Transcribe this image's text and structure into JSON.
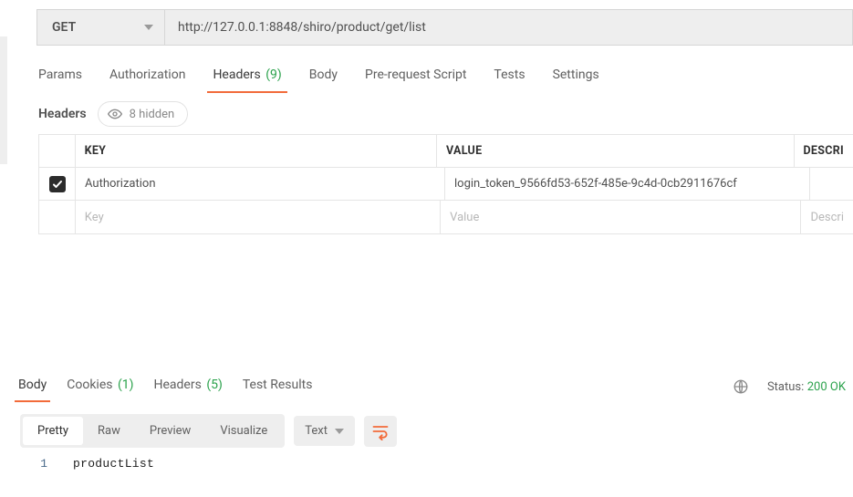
{
  "request": {
    "method": "GET",
    "url": "http://127.0.0.1:8848/shiro/product/get/list",
    "tabs": {
      "params": "Params",
      "authorization": "Authorization",
      "headers_label": "Headers",
      "headers_count": "(9)",
      "body": "Body",
      "prerequest": "Pre-request Script",
      "tests": "Tests",
      "settings": "Settings"
    }
  },
  "headers_section": {
    "title": "Headers",
    "hidden_label": "8 hidden",
    "columns": {
      "key": "KEY",
      "value": "VALUE",
      "desc": "DESCRI"
    },
    "row1": {
      "checked": true,
      "key": "Authorization",
      "value": "login_token_9566fd53-652f-485e-9c4d-0cb2911676cf"
    },
    "placeholders": {
      "key": "Key",
      "value": "Value",
      "desc": "Descri"
    }
  },
  "response": {
    "tabs": {
      "body": "Body",
      "cookies_label": "Cookies",
      "cookies_count": "(1)",
      "headers_label": "Headers",
      "headers_count": "(5)",
      "test_results": "Test Results"
    },
    "status_label": "Status:",
    "status_value": "200 OK",
    "view_modes": {
      "pretty": "Pretty",
      "raw": "Raw",
      "preview": "Preview",
      "visualize": "Visualize"
    },
    "content_type": "Text",
    "body_lines": {
      "l1_num": "1",
      "l1_text": "productList"
    }
  }
}
